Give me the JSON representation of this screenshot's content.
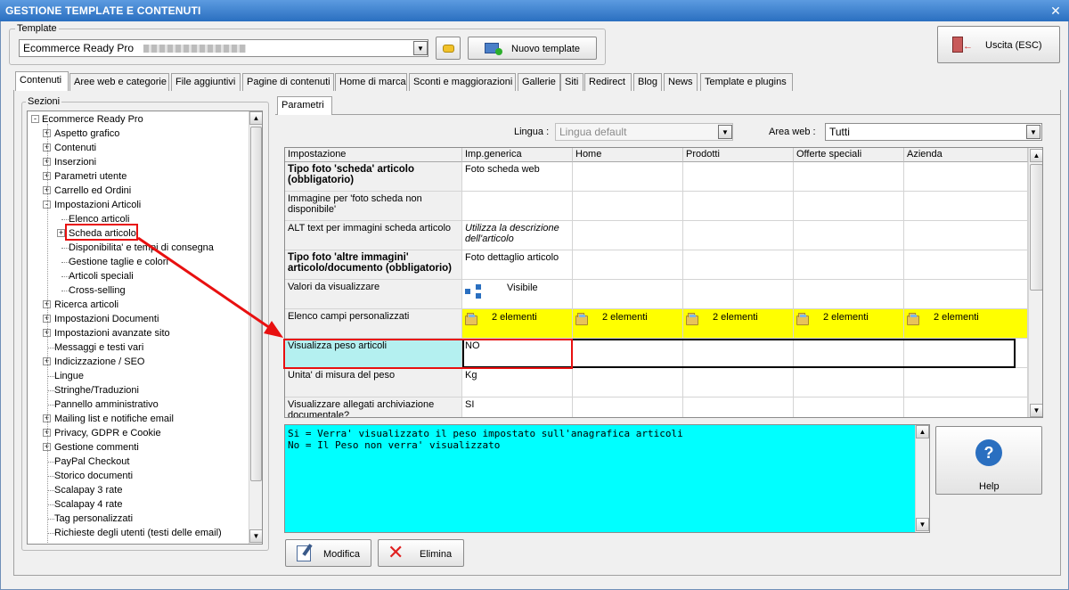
{
  "window": {
    "title": "GESTIONE TEMPLATE E CONTENUTI",
    "close": "✕"
  },
  "template_group": {
    "label": "Template",
    "combo_value": "Ecommerce Ready Pro",
    "new_button": "Nuovo template"
  },
  "exit_button": "Uscita (ESC)",
  "tabs": [
    "Contenuti",
    "Aree web e categorie",
    "File aggiuntivi",
    "Pagine di contenuti",
    "Home di marca",
    "Sconti e maggiorazioni",
    "Gallerie",
    "Siti",
    "Redirect",
    "Blog",
    "News",
    "Template e plugins"
  ],
  "sections_label": "Sezioni",
  "tree": {
    "root": "Ecommerce Ready Pro",
    "items": [
      {
        "label": "Aspetto grafico",
        "level": 1,
        "expander": "+"
      },
      {
        "label": "Contenuti",
        "level": 1,
        "expander": "+"
      },
      {
        "label": "Inserzioni",
        "level": 1,
        "expander": "+"
      },
      {
        "label": "Parametri utente",
        "level": 1,
        "expander": "+"
      },
      {
        "label": "Carrello ed Ordini",
        "level": 1,
        "expander": "+"
      },
      {
        "label": "Impostazioni Articoli",
        "level": 1,
        "expander": "-"
      },
      {
        "label": "Elenco articoli",
        "level": 2,
        "expander": ""
      },
      {
        "label": "Scheda articolo",
        "level": 2,
        "expander": "+"
      },
      {
        "label": "Disponibilita' e tempi di consegna",
        "level": 2,
        "expander": ""
      },
      {
        "label": "Gestione taglie e colori",
        "level": 2,
        "expander": ""
      },
      {
        "label": "Articoli speciali",
        "level": 2,
        "expander": ""
      },
      {
        "label": "Cross-selling",
        "level": 2,
        "expander": ""
      },
      {
        "label": "Ricerca articoli",
        "level": 1,
        "expander": "+"
      },
      {
        "label": "Impostazioni Documenti",
        "level": 1,
        "expander": "+"
      },
      {
        "label": "Impostazioni avanzate sito",
        "level": 1,
        "expander": "+"
      },
      {
        "label": "Messaggi e testi vari",
        "level": 1,
        "expander": ""
      },
      {
        "label": "Indicizzazione / SEO",
        "level": 1,
        "expander": "+"
      },
      {
        "label": "Lingue",
        "level": 1,
        "expander": ""
      },
      {
        "label": "Stringhe/Traduzioni",
        "level": 1,
        "expander": ""
      },
      {
        "label": "Pannello amministrativo",
        "level": 1,
        "expander": ""
      },
      {
        "label": "Mailing list e notifiche email",
        "level": 1,
        "expander": "+"
      },
      {
        "label": "Privacy, GDPR e Cookie",
        "level": 1,
        "expander": "+"
      },
      {
        "label": "Gestione commenti",
        "level": 1,
        "expander": "+"
      },
      {
        "label": "PayPal Checkout",
        "level": 1,
        "expander": ""
      },
      {
        "label": "Storico documenti",
        "level": 1,
        "expander": ""
      },
      {
        "label": "Scalapay 3 rate",
        "level": 1,
        "expander": ""
      },
      {
        "label": "Scalapay 4 rate",
        "level": 1,
        "expander": ""
      },
      {
        "label": "Tag personalizzati",
        "level": 1,
        "expander": ""
      },
      {
        "label": "Richieste degli utenti (testi delle email)",
        "level": 1,
        "expander": ""
      }
    ]
  },
  "params_tab": "Parametri",
  "filters": {
    "lingua_label": "Lingua :",
    "lingua_value": "Lingua default",
    "area_label": "Area web :",
    "area_value": "Tutti"
  },
  "grid": {
    "headers": [
      "Impostazione",
      "Imp.generica",
      "Home",
      "Prodotti",
      "Offerte speciali",
      "Azienda"
    ],
    "rows": [
      {
        "setting": "Tipo foto 'scheda' articolo (obbligatorio)",
        "bold": true,
        "value": "Foto scheda web"
      },
      {
        "setting": "Immagine per 'foto scheda non disponibile'",
        "bold": false,
        "value": ""
      },
      {
        "setting": "ALT text per immagini scheda articolo",
        "bold": false,
        "value": "Utilizza la descrizione dell'articolo",
        "italic": true
      },
      {
        "setting": "Tipo foto 'altre immagini' articolo/documento (obbligatorio)",
        "bold": true,
        "value": "Foto dettaglio articolo"
      },
      {
        "setting": "Valori da visualizzare",
        "bold": false,
        "value": "Visibile"
      },
      {
        "setting": "Elenco campi personalizzati",
        "bold": false,
        "value": "2 elementi",
        "per_area": [
          "2 elementi",
          "2 elementi",
          "2 elementi",
          "2 elementi"
        ]
      },
      {
        "setting": "Visualizza peso articoli",
        "bold": false,
        "value": "NO",
        "selected": true
      },
      {
        "setting": "Unita' di misura del peso",
        "bold": false,
        "value": "Kg"
      },
      {
        "setting": "Visualizzare allegati archiviazione documentale?",
        "bold": false,
        "value": "SI"
      }
    ]
  },
  "description": "Si = Verra' visualizzato il peso impostato sull'anagrafica articoli\nNo = Il Peso non verra' visualizzato",
  "help_button": "Help",
  "edit_button": "Modifica",
  "delete_button": "Elimina",
  "colors": {
    "titlebar": "#2a6fc0",
    "description_bg": "#00ffff",
    "highlight_yellow": "#ffff00",
    "selected_cell": "#b4f0f0",
    "annotation_red": "#e81010"
  }
}
